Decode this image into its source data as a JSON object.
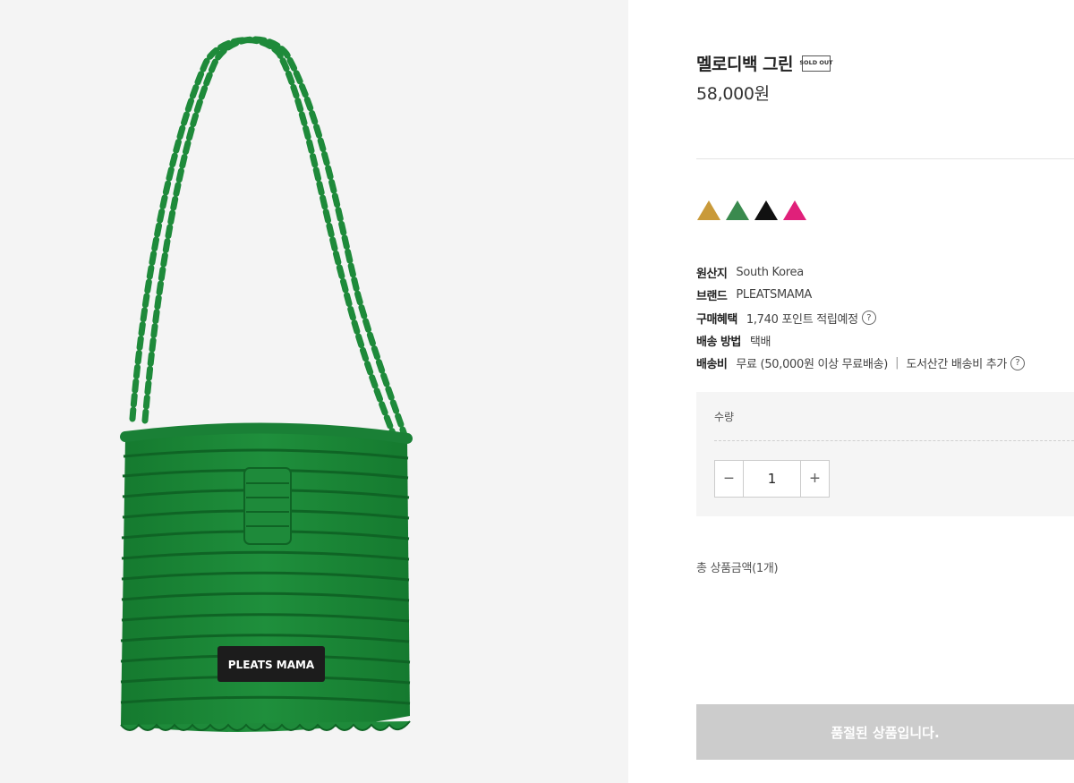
{
  "product": {
    "title": "멜로디백 그린",
    "soldout_badge": "SOLD OUT",
    "price": "58,000원",
    "image_label": "PLEATS MAMA"
  },
  "colors": {
    "bag_green": "#1e8a3a",
    "swatches": [
      "#c99a3a",
      "#3a8a4e",
      "#111111",
      "#e0207a"
    ]
  },
  "specs": {
    "origin_label": "원산지",
    "origin_value": "South Korea",
    "brand_label": "브랜드",
    "brand_value": "PLEATSMAMA",
    "benefit_label": "구매혜택",
    "benefit_value": "1,740 포인트 적립예정",
    "shipping_method_label": "배송 방법",
    "shipping_method_value": "택배",
    "shipping_fee_label": "배송비",
    "shipping_fee_value": "무료 (50,000원 이상 무료배송)",
    "shipping_fee_extra": "도서산간 배송비 추가",
    "separator": "|",
    "help_icon": "?"
  },
  "quantity": {
    "label": "수량",
    "value": "1",
    "minus": "−",
    "plus": "+"
  },
  "total": {
    "label": "총 상품금액(1개)"
  },
  "actions": {
    "soldout_button": "품절된 상품입니다."
  }
}
